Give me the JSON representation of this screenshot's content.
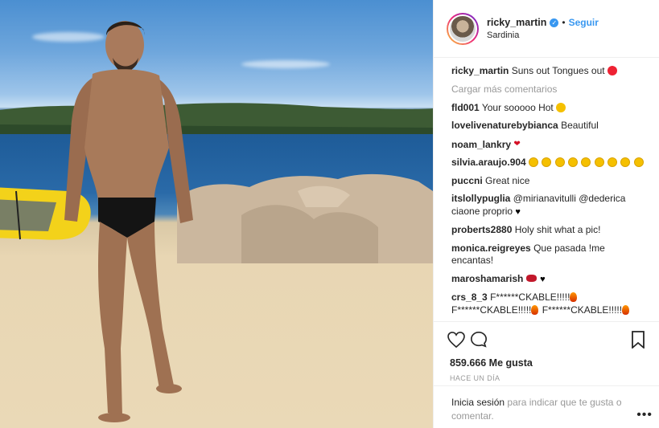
{
  "post": {
    "username": "ricky_martin",
    "verified_icon": "verified-badge-icon",
    "separator": "•",
    "follow_label": "Seguir",
    "location": "Sardinia",
    "caption_user": "ricky_martin",
    "caption_text": "Suns out Tongues out",
    "load_more": "Cargar más comentarios"
  },
  "comments": [
    {
      "user": "fld001",
      "text": "Your sooooo Hot"
    },
    {
      "user": "lovelivenaturebybianca",
      "text": "Beautiful"
    },
    {
      "user": "noam_lankry",
      "text": ""
    },
    {
      "user": "silvia.araujo.904",
      "text": ""
    },
    {
      "user": "puccni",
      "text": "Great nice"
    },
    {
      "user": "itslollypuglia",
      "text": "@mirianavitulli @dederica ciaone proprio"
    },
    {
      "user": "proberts2880",
      "text": "Holy shit what a pic!"
    },
    {
      "user": "monica.reigreyes",
      "text": "Que pasada !me encantas!"
    },
    {
      "user": "maroshamarish",
      "text": ""
    },
    {
      "user": "crs_8_3",
      "text": "F******CKABLE!!!!!"
    },
    {
      "user": "",
      "text": "F******CKABLE!!!!!"
    },
    {
      "user": "",
      "text": "F******CKABLE!!!!!"
    }
  ],
  "footer": {
    "likes": "859.666 Me gusta",
    "time": "HACE UN DÍA",
    "login_link": "Inicia sesión",
    "login_text": "para indicar que te gusta o comentar.",
    "more": "•••"
  },
  "colors": {
    "accent": "#3897f0",
    "text": "#262626",
    "muted": "#999999"
  }
}
